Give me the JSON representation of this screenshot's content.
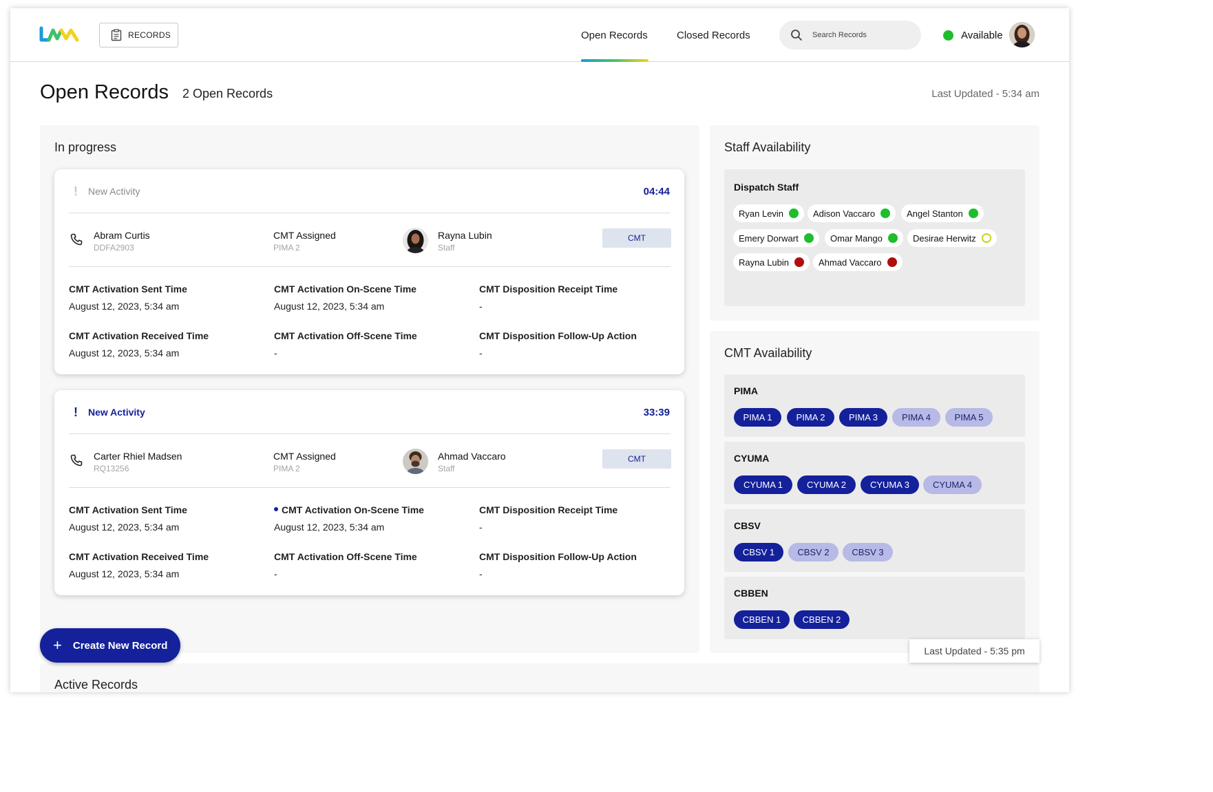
{
  "header": {
    "logo_icon": "lvm-logo",
    "records_button": "RECORDS",
    "tabs": [
      {
        "label": "Open Records",
        "active": true
      },
      {
        "label": "Closed Records",
        "active": false
      }
    ],
    "search_placeholder": "Search Records",
    "status_label": "Available",
    "status_color": "#1fbd2d"
  },
  "page": {
    "title": "Open Records",
    "count_label": "2 Open Records",
    "last_updated": "Last Updated - 5:34 am"
  },
  "in_progress": {
    "title": "In progress",
    "records": [
      {
        "activity_label": "New Activity",
        "activity_active": false,
        "timer": "04:44",
        "caller_name": "Abram Curtis",
        "caller_id": "DDFA2903",
        "assigned_label": "CMT Assigned",
        "assigned_unit": "PIMA 2",
        "staff_name": "Rayna Lubin",
        "staff_role": "Staff",
        "cmt_button": "CMT",
        "fields": {
          "sent_label": "CMT Activation Sent Time",
          "sent_value": "August 12, 2023, 5:34 am",
          "onscene_label": "CMT Activation On-Scene Time",
          "onscene_value": "August 12, 2023, 5:34 am",
          "receipt_label": "CMT Disposition Receipt Time",
          "receipt_value": "-",
          "received_label": "CMT Activation Received Time",
          "received_value": "August 12, 2023, 5:34 am",
          "offscene_label": "CMT Activation Off-Scene Time",
          "offscene_value": "-",
          "followup_label": "CMT Disposition Follow-Up Action",
          "followup_value": "-"
        }
      },
      {
        "activity_label": "New Activity",
        "activity_active": true,
        "timer": "33:39",
        "caller_name": "Carter Rhiel Madsen",
        "caller_id": "RQ13256",
        "assigned_label": "CMT Assigned",
        "assigned_unit": "PIMA 2",
        "staff_name": "Ahmad Vaccaro",
        "staff_role": "Staff",
        "cmt_button": "CMT",
        "fields": {
          "sent_label": "CMT Activation Sent Time",
          "sent_value": "August 12, 2023, 5:34 am",
          "onscene_label": "CMT Activation On-Scene Time",
          "onscene_value": "August 12, 2023, 5:34 am",
          "receipt_label": "CMT Disposition Receipt Time",
          "receipt_value": "-",
          "received_label": "CMT Activation Received Time",
          "received_value": "August 12, 2023, 5:34 am",
          "offscene_label": "CMT Activation Off-Scene Time",
          "offscene_value": "-",
          "followup_label": "CMT Disposition Follow-Up Action",
          "followup_value": "-"
        }
      }
    ],
    "create_button": "Create New Record"
  },
  "staff_availability": {
    "title": "Staff Availability",
    "group_title": "Dispatch Staff",
    "staff": [
      {
        "name": "Ryan Levin",
        "status": "available",
        "color": "#1fbd2d"
      },
      {
        "name": "Adison Vaccaro",
        "status": "available",
        "color": "#1fbd2d"
      },
      {
        "name": "Angel Stanton",
        "status": "available",
        "color": "#1fbd2d"
      },
      {
        "name": "Emery Dorwart",
        "status": "available",
        "color": "#1fbd2d"
      },
      {
        "name": "Omar Mango",
        "status": "available",
        "color": "#1fbd2d"
      },
      {
        "name": "Desirae Herwitz",
        "status": "away",
        "color": "#c8d41a"
      },
      {
        "name": "Rayna Lubin",
        "status": "busy",
        "color": "#b00d0d"
      },
      {
        "name": "Ahmad Vaccaro",
        "status": "busy",
        "color": "#b00d0d"
      }
    ]
  },
  "cmt_availability": {
    "title": "CMT Availability",
    "groups": [
      {
        "name": "PIMA",
        "units": [
          {
            "label": "PIMA 1",
            "available": true
          },
          {
            "label": "PIMA 2",
            "available": true
          },
          {
            "label": "PIMA 3",
            "available": true
          },
          {
            "label": "PIMA 4",
            "available": false
          },
          {
            "label": "PIMA 5",
            "available": false
          }
        ]
      },
      {
        "name": "CYUMA",
        "units": [
          {
            "label": "CYUMA 1",
            "available": true
          },
          {
            "label": "CYUMA 2",
            "available": true
          },
          {
            "label": "CYUMA 3",
            "available": true
          },
          {
            "label": "CYUMA 4",
            "available": false
          }
        ]
      },
      {
        "name": "CBSV",
        "units": [
          {
            "label": "CBSV 1",
            "available": true
          },
          {
            "label": "CBSV 2",
            "available": false
          },
          {
            "label": "CBSV 3",
            "available": false
          }
        ]
      },
      {
        "name": "CBBEN",
        "units": [
          {
            "label": "CBBEN 1",
            "available": true
          },
          {
            "label": "CBBEN 2",
            "available": true
          }
        ]
      }
    ]
  },
  "toast": {
    "text": "Last Updated - 5:35 pm"
  },
  "active_records": {
    "title": "Active Records"
  },
  "colors": {
    "primary": "#14219b",
    "unit_unavailable": "#b7b9e6",
    "available": "#1fbd2d",
    "busy": "#b00d0d",
    "away": "#c8d41a"
  }
}
